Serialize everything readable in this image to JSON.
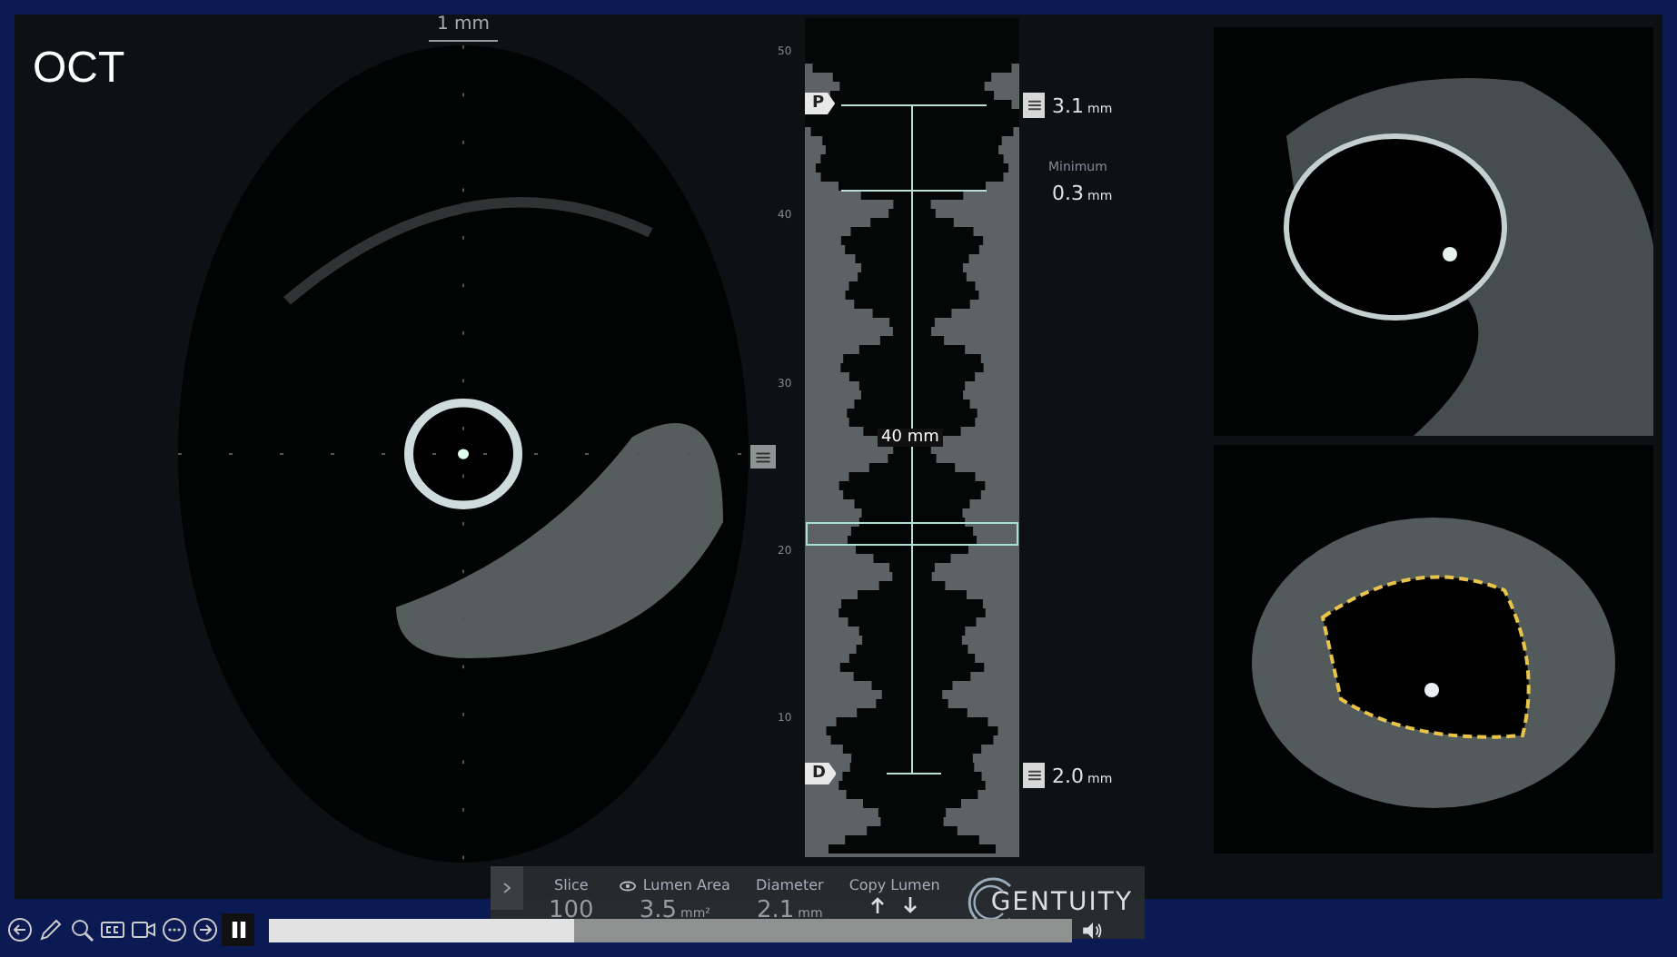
{
  "title": "OCT",
  "scale_bar": {
    "label": "1 mm"
  },
  "longitudinal": {
    "ticks": [
      "50",
      "40",
      "30",
      "20",
      "10"
    ],
    "proximal": {
      "marker": "P",
      "reading": "3.1",
      "unit": "mm"
    },
    "minimum": {
      "label": "Minimum",
      "reading": "0.3",
      "unit": "mm"
    },
    "distal": {
      "marker": "D",
      "reading": "2.0",
      "unit": "mm"
    },
    "length": "40 mm"
  },
  "measurements": {
    "slice": {
      "label": "Slice",
      "value": "100"
    },
    "lumen_area": {
      "label": "Lumen Area",
      "value": "3.5",
      "unit": "mm²"
    },
    "diameter": {
      "label": "Diameter",
      "value": "2.1",
      "unit": "mm"
    },
    "copy_lumen": {
      "label": "Copy Lumen"
    }
  },
  "brand": "GENTUITY",
  "player": {
    "playing": true,
    "level": 0.38
  }
}
